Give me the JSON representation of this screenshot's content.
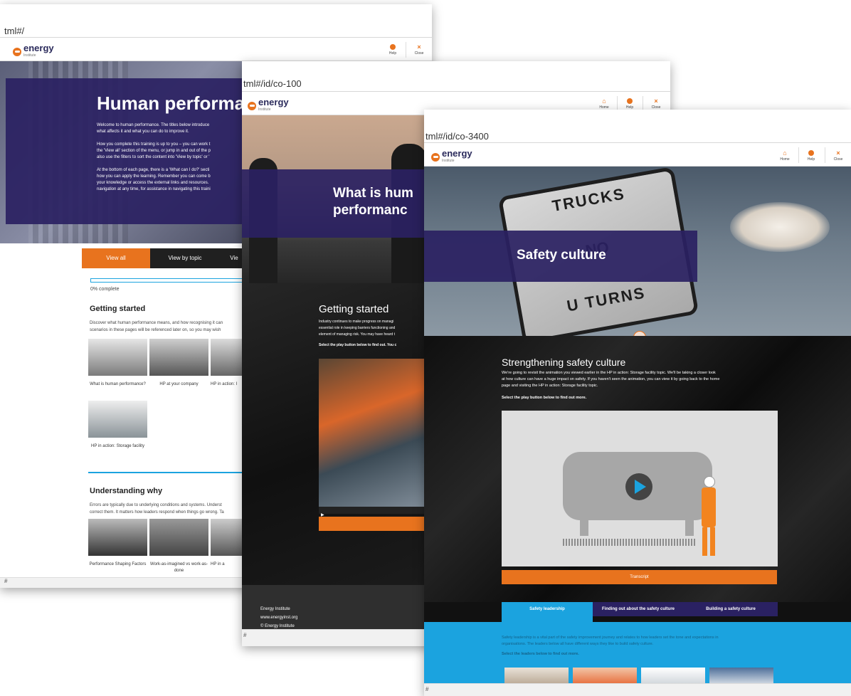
{
  "win1": {
    "url": "tml#/",
    "logo": "energy",
    "logo_sub": "Institute",
    "help_label": "Help",
    "close_label": "Close",
    "hero_title": "Human performan",
    "intro": [
      "Welcome to human performance. The titles below introduce",
      "what affects it and what you can do to improve it.",
      "How you complete this training is up to you – you can work t",
      "the 'View all' section of the menu, or jump in and out of the p",
      "also use the filters to sort the content into 'View by topic' or '",
      "At the bottom of each page, there is a 'What can I do?' secti",
      "how you can apply the learning. Remember you can come b",
      "your knowledge or access the external links and resources.",
      "navigation at any time, for assistance in navigating this traini"
    ],
    "tabs": [
      "View all",
      "View by topic",
      "Vie"
    ],
    "progress": "0% complete",
    "progress_value": 0,
    "section1_title": "Getting started",
    "section1_text": [
      "Discover what human performance means, and how recognising it can",
      "scenarios in these pages will be referenced later on, so you may wish"
    ],
    "cards1": [
      "What is human performance?",
      "HP at your company",
      "HP in action: I",
      "HP in action: Storage facility"
    ],
    "section2_title": "Understanding why",
    "section2_text": [
      "Errors are typically due to underlying conditions and systems. Underst",
      "correct them. It matters how leaders respond when things go wrong. Ta"
    ],
    "cards2": [
      "Performance Shaping Factors",
      "Work-as-imagined vs work-as-done",
      "HP in a"
    ],
    "status": "#"
  },
  "win2": {
    "url": "tml#/id/co-100",
    "logo": "energy",
    "logo_sub": "Institute",
    "home_label": "Home",
    "help_label": "Help",
    "close_label": "Close",
    "hero_title_1": "What is hum",
    "hero_title_2": "performanc",
    "section_title": "Getting started",
    "text": [
      "Industry continues to make progress on managi",
      "essential role in keeping barriers functioning and",
      "element of managing risk. You may have heard t"
    ],
    "cta": "Select the play button below to find out. You c",
    "footer_lines": [
      "Energy Institute",
      "www.energyinst.org",
      "© Energy Institute"
    ],
    "status": "#"
  },
  "win3": {
    "url": "tml#/id/co-3400",
    "logo": "energy",
    "logo_sub": "Institute",
    "home_label": "Home",
    "help_label": "Help",
    "close_label": "Close",
    "sign_line1": "TRUCKS",
    "sign_line2": "NO",
    "sign_line3": "U TURNS",
    "hero_title": "Safety culture",
    "section_title": "Strengthening safety culture",
    "text": [
      "We're going to revisit the animation you viewed earlier in the HP in action: Storage facility topic. We'll be taking a closer look",
      "at how culture can have a huge impact on safety. If you haven't seen the animation, you can view it by going back to the home",
      "page and visiting the HP in action: Storage facility topic."
    ],
    "cta": "Select the play button below to find out more.",
    "transcript": "Transcript",
    "tabs": [
      "Safety leadership",
      "Finding out about the safety culture",
      "Building a safety culture"
    ],
    "blue_text": [
      "Safety leadership is a vital part of the safety improvement journey and relates to how leaders set the tone and expectations in",
      "organisations. The leaders below all have different ways they like to build safety culture."
    ],
    "blue_cta": "Select the leaders below to find out more.",
    "status": "#"
  },
  "colors": {
    "orange": "#e8731e",
    "navy": "#2a2162",
    "blue": "#1ba3df",
    "dark": "#141414"
  }
}
